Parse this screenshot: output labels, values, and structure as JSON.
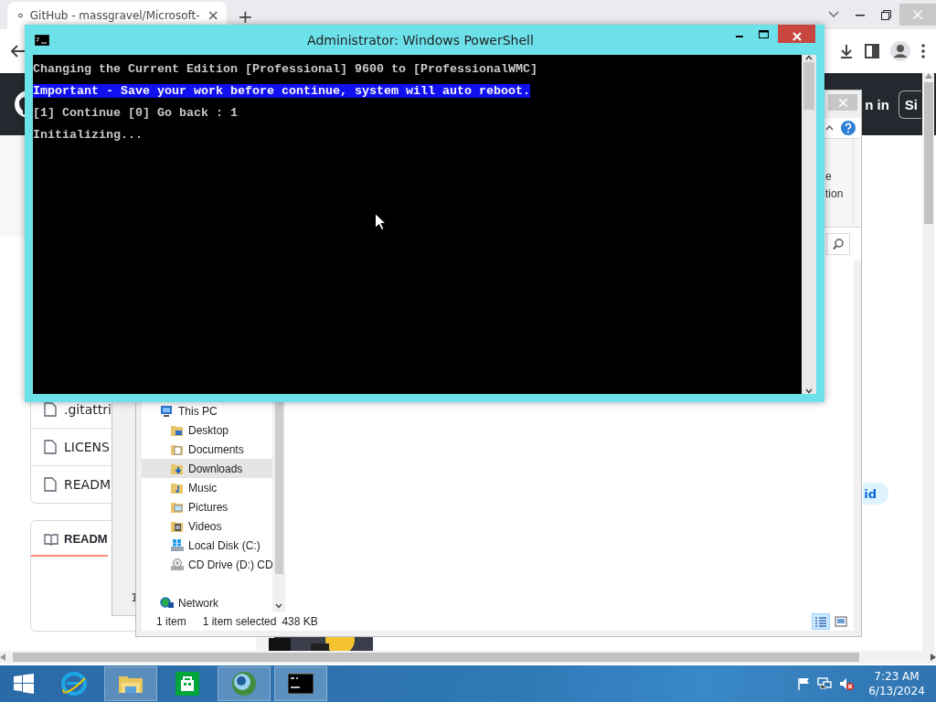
{
  "browser": {
    "tab": {
      "title": "GitHub - massgravel/Microsoft-",
      "close": "×",
      "selected": true
    },
    "new_tab": "+",
    "header": {
      "sign_in": "n in",
      "sign_up": "Si"
    },
    "files": [
      {
        "name": ".gitattri"
      },
      {
        "name": "LICENS"
      },
      {
        "name": "READM"
      }
    ],
    "readme_tab": {
      "label": "READM",
      "selected": true
    },
    "pill": "id"
  },
  "behind_window": {
    "status": "1"
  },
  "explorer": {
    "ribbon_fragments": [
      "e",
      "tion"
    ],
    "nav": [
      {
        "label": "This PC",
        "kind": "pc",
        "selected": false,
        "children": [
          {
            "label": "Desktop",
            "kind": "desktop",
            "selected": false
          },
          {
            "label": "Documents",
            "kind": "documents",
            "selected": false
          },
          {
            "label": "Downloads",
            "kind": "downloads",
            "selected": true
          },
          {
            "label": "Music",
            "kind": "music",
            "selected": false
          },
          {
            "label": "Pictures",
            "kind": "pictures",
            "selected": false
          },
          {
            "label": "Videos",
            "kind": "videos",
            "selected": false
          },
          {
            "label": "Local Disk (C:)",
            "kind": "disk",
            "selected": false
          },
          {
            "label": "CD Drive (D:) CD",
            "kind": "cd",
            "selected": false
          }
        ]
      },
      {
        "label": "Network",
        "kind": "network",
        "selected": false
      }
    ],
    "status": {
      "count": "1 item",
      "selection": "1 item selected",
      "size": "438 KB"
    },
    "views": [
      {
        "kind": "details",
        "selected": true
      },
      {
        "kind": "preview",
        "selected": false
      }
    ]
  },
  "powershell": {
    "title": "Administrator: Windows PowerShell",
    "lines": [
      {
        "text": "Changing the Current Edition [Professional] 9600 to [ProfessionalWMC]",
        "highlighted": false
      },
      {
        "text": "Important - Save your work before continue, system will auto reboot.",
        "highlighted": true
      },
      {
        "text": "[1] Continue [0] Go back : 1",
        "highlighted": false
      },
      {
        "text": "Initializing...",
        "highlighted": false
      }
    ]
  },
  "taskbar": {
    "apps": [
      {
        "kind": "ie",
        "active": false
      },
      {
        "kind": "explorer",
        "active": true
      },
      {
        "kind": "store",
        "active": false
      },
      {
        "kind": "globe",
        "active": true
      },
      {
        "kind": "powershell",
        "active": true
      }
    ],
    "clock": {
      "time": "7:23 AM",
      "date": "6/13/2024"
    }
  }
}
